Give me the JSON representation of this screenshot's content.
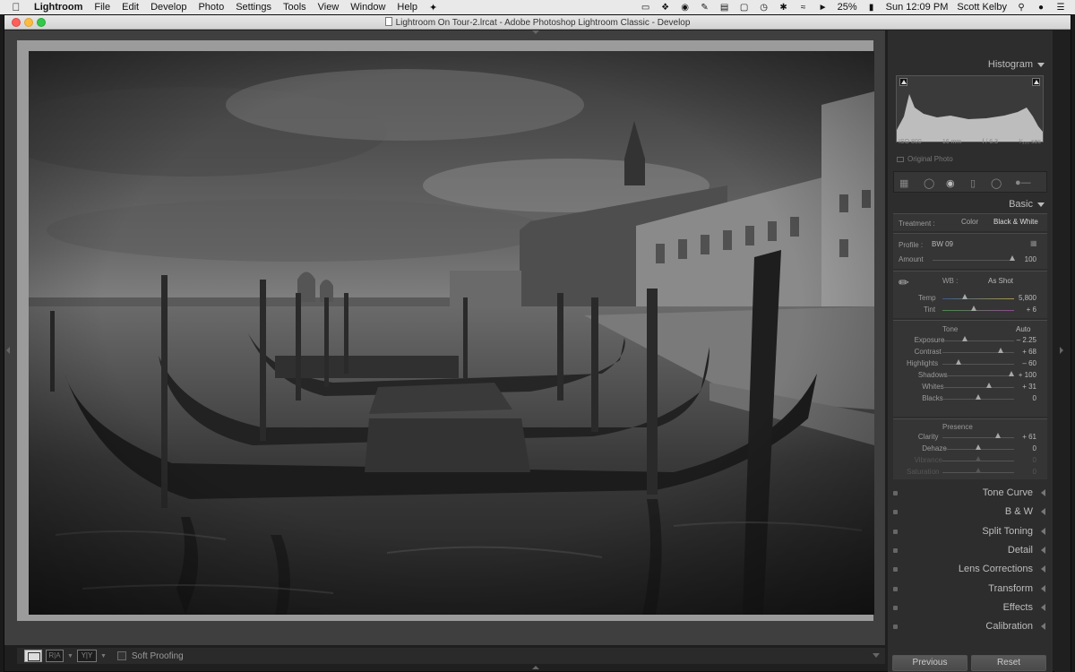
{
  "menubar": {
    "app": "Lightroom",
    "items": [
      "File",
      "Edit",
      "Develop",
      "Photo",
      "Settings",
      "Tools",
      "View",
      "Window",
      "Help"
    ],
    "battery": "25%",
    "clock": "Sun 12:09 PM",
    "user": "Scott Kelby"
  },
  "window": {
    "title": "Lightroom On Tour-2.lrcat - Adobe Photoshop Lightroom Classic - Develop"
  },
  "histogram": {
    "title": "Histogram",
    "iso": "ISO 800",
    "focal": "16 mm",
    "aperture": "f / 6.3",
    "shutter": "¹⁄₃₂₀ sec",
    "original_photo": "Original Photo"
  },
  "basic": {
    "title": "Basic",
    "treatment_label": "Treatment :",
    "color": "Color",
    "bw": "Black & White",
    "profile_label": "Profile :",
    "profile_value": "BW 09",
    "amount_label": "Amount",
    "amount_value": "100",
    "amount_level": 1.0,
    "wb_label": "WB :",
    "wb_value": "As Shot",
    "temp_label": "Temp",
    "temp_value": "5,800",
    "tint_label": "Tint",
    "tint_value": "+ 6",
    "tone_label": "Tone",
    "auto_label": "Auto",
    "tone_sliders": [
      {
        "label": "Exposure",
        "value": "– 2.25",
        "level": 0.3
      },
      {
        "label": "Contrast",
        "value": "+ 68",
        "level": 0.84
      },
      {
        "label": "Highlights",
        "value": "– 60",
        "level": 0.2
      },
      {
        "label": "Shadows",
        "value": "+ 100",
        "level": 1.0
      },
      {
        "label": "Whites",
        "value": "+ 31",
        "level": 0.66
      },
      {
        "label": "Blacks",
        "value": "0",
        "level": 0.5
      }
    ],
    "presence_label": "Presence",
    "presence_sliders": [
      {
        "label": "Clarity",
        "value": "+ 61",
        "level": 0.8
      },
      {
        "label": "Dehaze",
        "value": "0",
        "level": 0.5
      },
      {
        "label": "Vibrance",
        "value": "0",
        "level": 0.5
      },
      {
        "label": "Saturation",
        "value": "0",
        "level": 0.5
      }
    ]
  },
  "panels": [
    "Tone Curve",
    "B & W",
    "Split Toning",
    "Detail",
    "Lens Corrections",
    "Transform",
    "Effects",
    "Calibration"
  ],
  "buttons": {
    "previous": "Previous",
    "reset": "Reset"
  },
  "toolbar": {
    "soft_proofing": "Soft Proofing",
    "ra": "R|A",
    "yy": "Y|Y"
  }
}
